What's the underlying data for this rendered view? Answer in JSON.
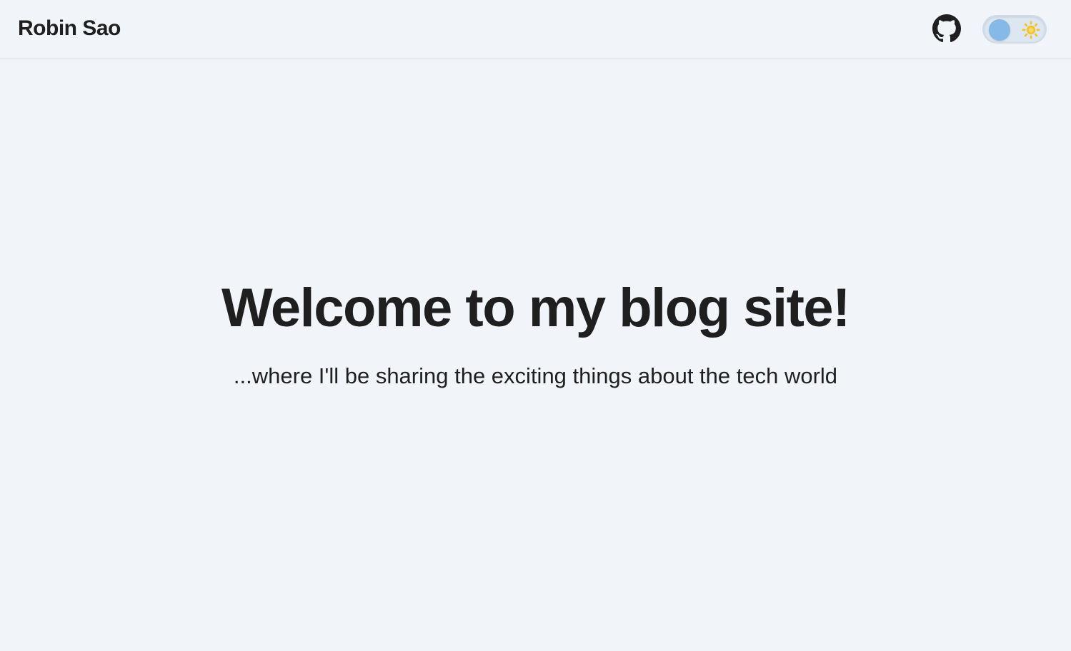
{
  "header": {
    "brand": "Robin Sao",
    "github_icon": "github-icon",
    "theme_toggle": {
      "state": "light",
      "icon": "sun-icon",
      "knob_color": "#86b9e6",
      "sun_color": "#f2c230"
    }
  },
  "hero": {
    "title": "Welcome to my blog site!",
    "subtitle": "...where I'll be sharing the exciting things about the tech world"
  },
  "colors": {
    "background": "#f1f4f9",
    "text": "#1f1f1f",
    "divider": "#d6d9de"
  }
}
